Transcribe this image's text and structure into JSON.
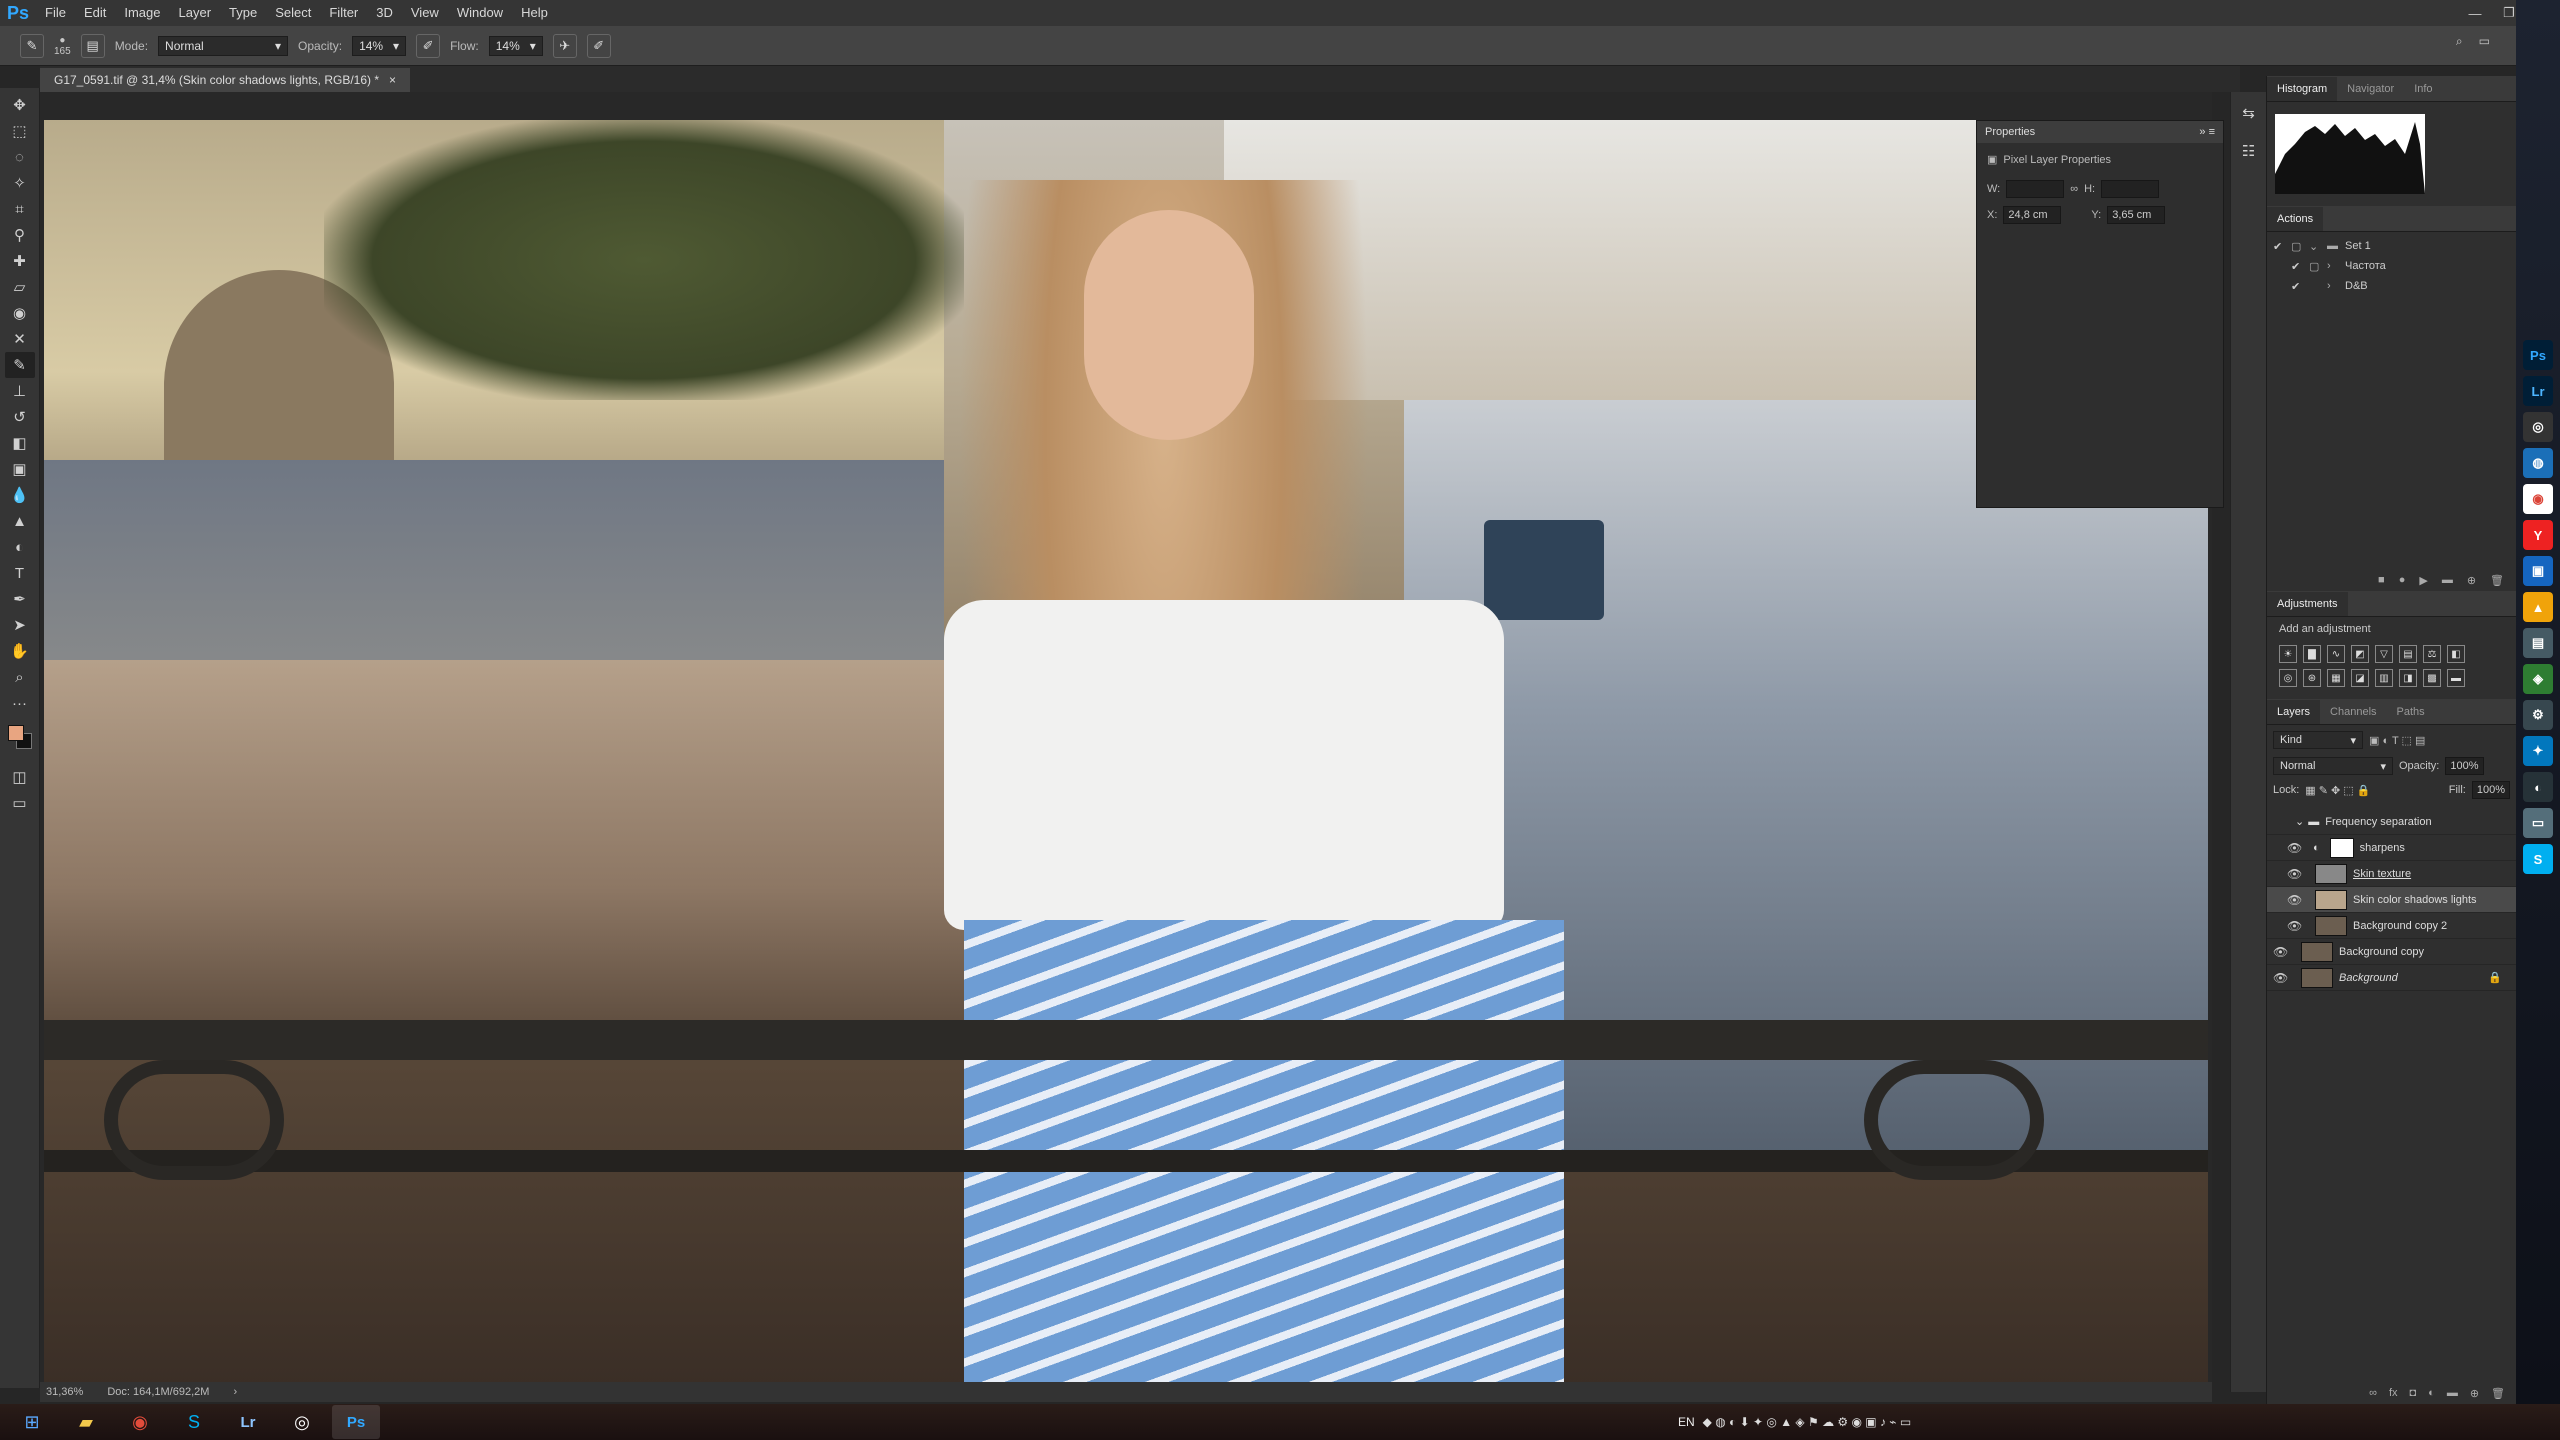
{
  "menubar": {
    "logo": "Ps",
    "items": [
      "File",
      "Edit",
      "Image",
      "Layer",
      "Type",
      "Select",
      "Filter",
      "3D",
      "View",
      "Window",
      "Help"
    ],
    "window_controls": [
      "—",
      "❐",
      "✕"
    ]
  },
  "options": {
    "brush_size": "165",
    "mode_label": "Mode:",
    "mode_value": "Normal",
    "opacity_label": "Opacity:",
    "opacity_value": "14%",
    "flow_label": "Flow:",
    "flow_value": "14%"
  },
  "document": {
    "tab_title": "G17_0591.tif @ 31,4% (Skin color shadows lights, RGB/16) *",
    "tab_close": "×"
  },
  "status": {
    "zoom": "31,36%",
    "doc": "Doc: 164,1M/692,2M"
  },
  "properties": {
    "title": "Properties",
    "subtitle": "Pixel Layer Properties",
    "w_label": "W:",
    "h_label": "H:",
    "x_label": "X:",
    "x_value": "24,8 cm",
    "y_label": "Y:",
    "y_value": "3,65 cm"
  },
  "top_panel": {
    "tabs": [
      "Histogram",
      "Navigator",
      "Info"
    ]
  },
  "actions": {
    "title": "Actions",
    "items": [
      "Set 1",
      "Частота",
      "D&B"
    ]
  },
  "adjustments": {
    "title": "Adjustments",
    "add_label": "Add an adjustment"
  },
  "layers": {
    "tabs": [
      "Layers",
      "Channels",
      "Paths"
    ],
    "kind_label": "Kind",
    "blend_mode": "Normal",
    "opacity_label": "Opacity:",
    "opacity_value": "100%",
    "lock_label": "Lock:",
    "fill_label": "Fill:",
    "fill_value": "100%",
    "items": [
      {
        "name": "Frequency separation",
        "type": "group"
      },
      {
        "name": "sharpens",
        "type": "adjustment"
      },
      {
        "name": "Skin texture",
        "type": "layer"
      },
      {
        "name": "Skin color shadows lights",
        "type": "layer",
        "selected": true
      },
      {
        "name": "Background copy 2",
        "type": "layer"
      },
      {
        "name": "Background copy",
        "type": "layer"
      },
      {
        "name": "Background",
        "type": "locked"
      }
    ]
  },
  "taskbar": {
    "lang": "EN",
    "apps": [
      "Start",
      "Explorer",
      "Chrome",
      "Skype",
      "Lr",
      "Camera",
      "Ps"
    ]
  },
  "colors": {
    "accent": "#31a8ff",
    "foreground": "#e8a581",
    "background": "#111111"
  }
}
